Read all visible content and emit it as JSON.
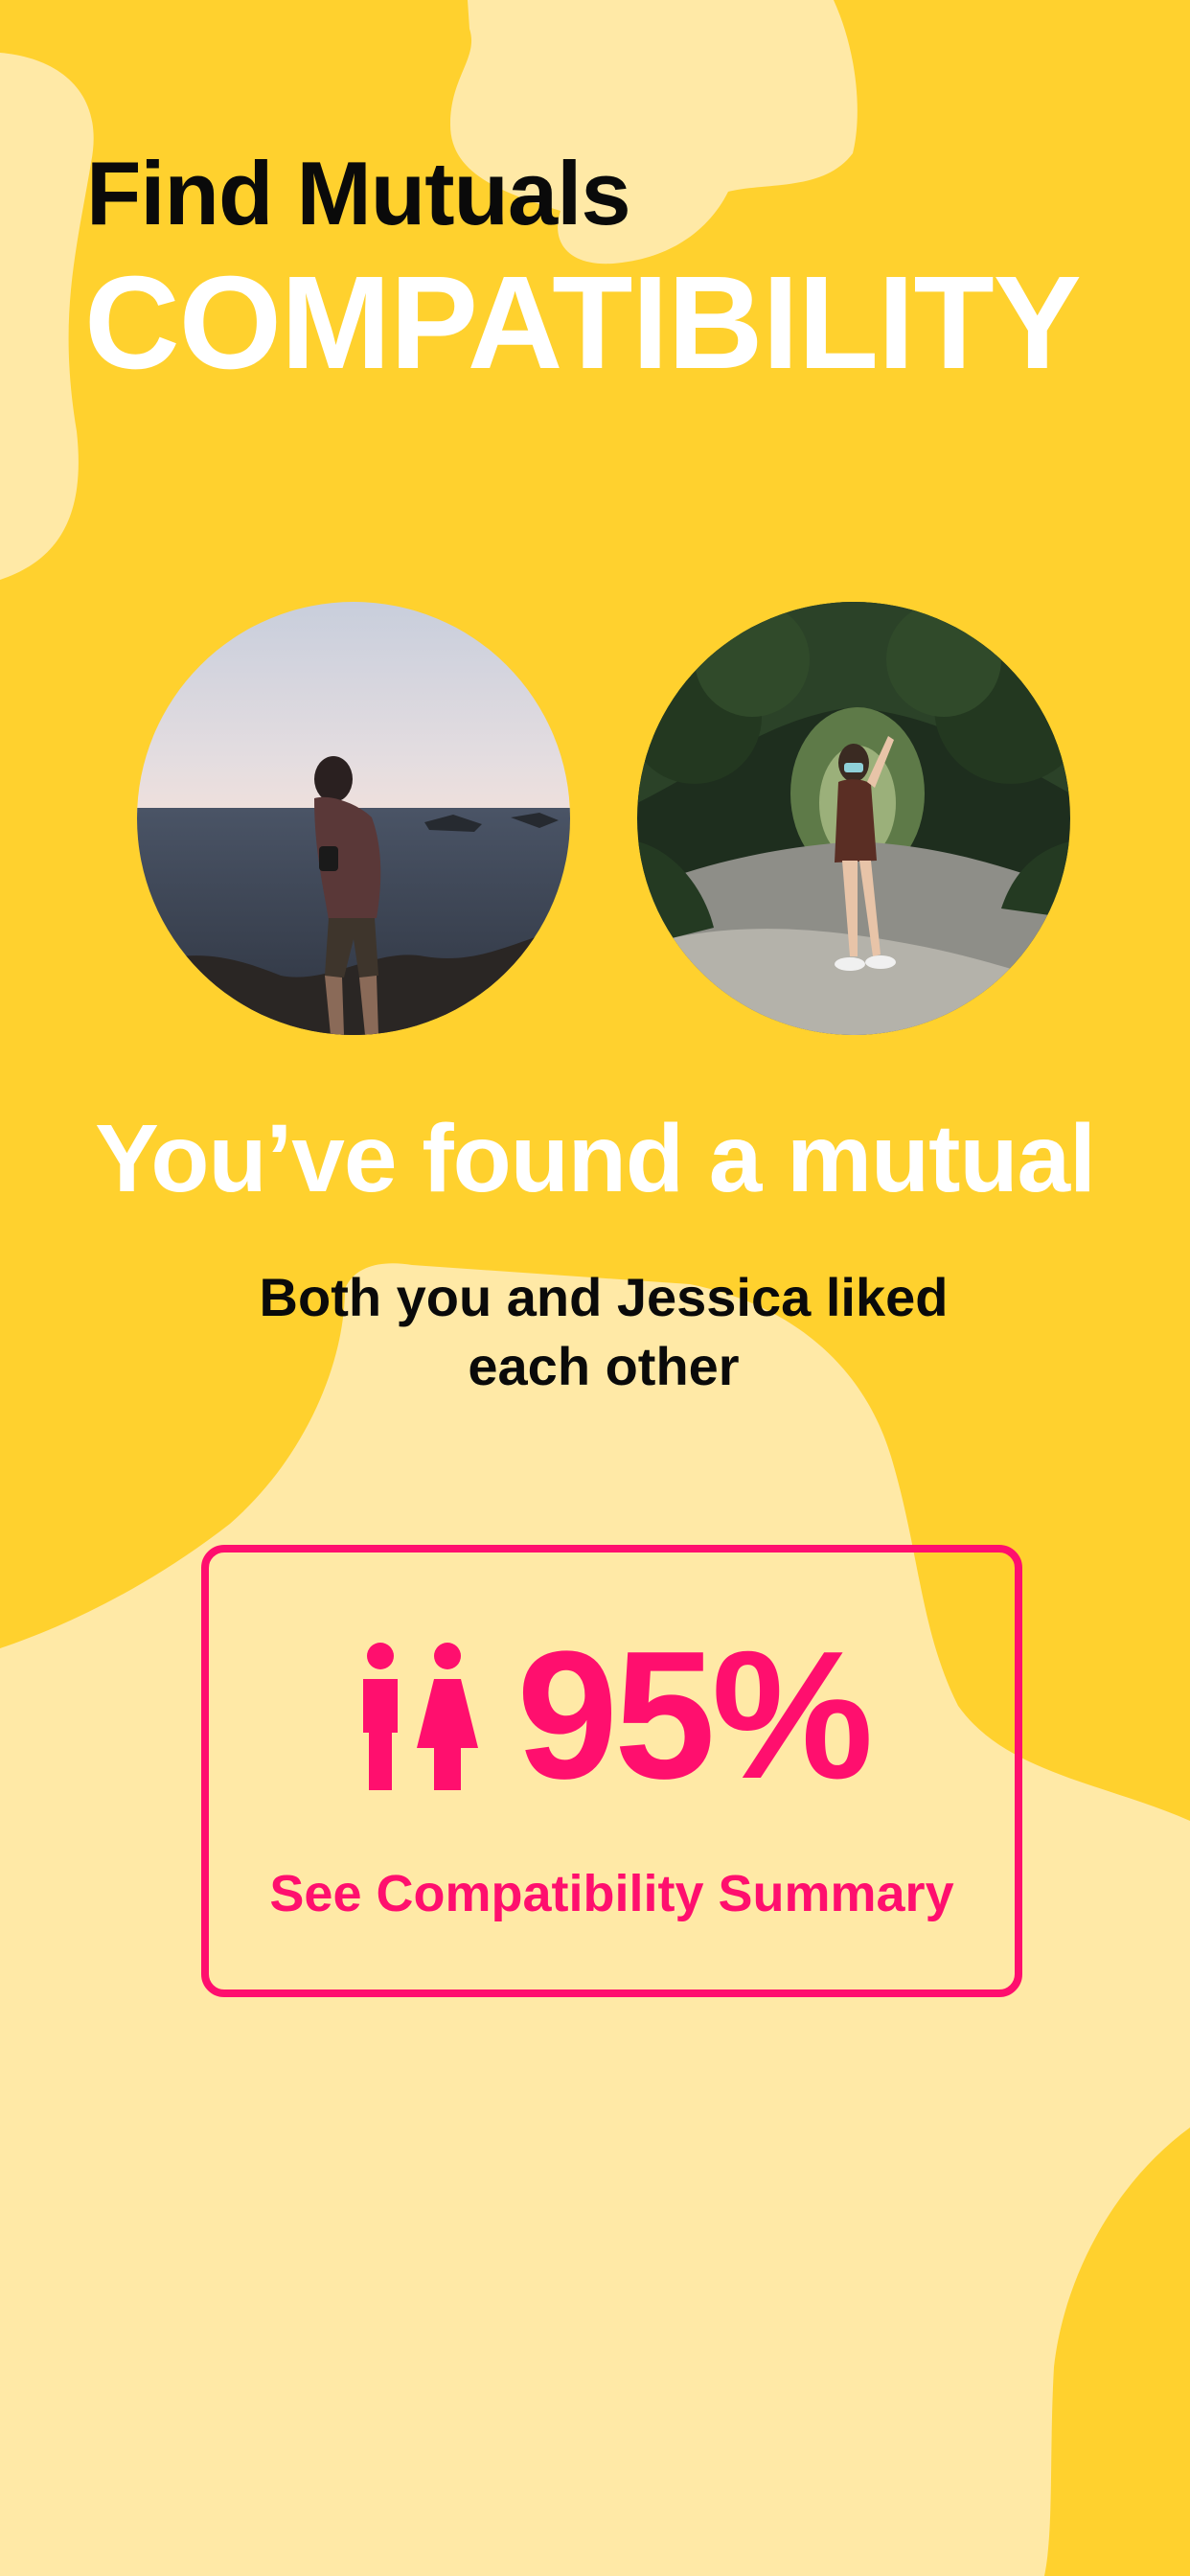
{
  "header": {
    "title": "Find Mutuals",
    "subtitle": "COMPATIBILITY"
  },
  "match": {
    "headline": "You’ve found a mutual",
    "message": "Both you and Jessica liked each other"
  },
  "profiles": [
    {
      "photo_icon": "man-on-coast-photo"
    },
    {
      "photo_icon": "woman-in-garden-photo"
    }
  ],
  "compatibility": {
    "icon": "couple-icon",
    "score": "95%",
    "link_label": "See Compatibility Summary"
  },
  "colors": {
    "background": "#FFD12E",
    "blob": "#FFE9A6",
    "accent": "#FF0F6E",
    "heading_dark": "#0A0A0A",
    "heading_light": "#FFFFFF"
  }
}
